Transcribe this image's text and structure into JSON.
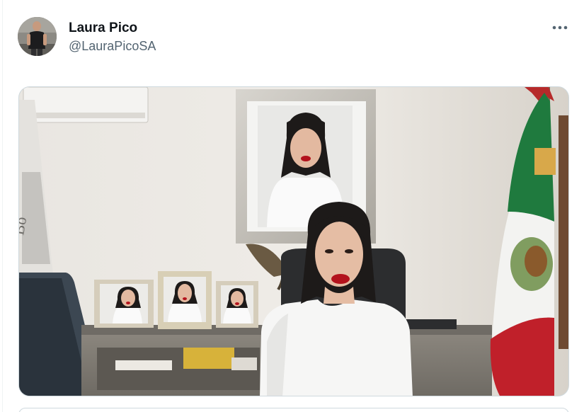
{
  "tweet": {
    "author": {
      "display_name": "Laura Pico",
      "handle": "@LauraPicoSA"
    },
    "more_icon": "more-horizontal-icon",
    "media": {
      "kind": "photo",
      "alt_text": ""
    }
  },
  "colors": {
    "text_primary": "#0f1419",
    "text_secondary": "#536471",
    "border": "#cfd9de"
  }
}
